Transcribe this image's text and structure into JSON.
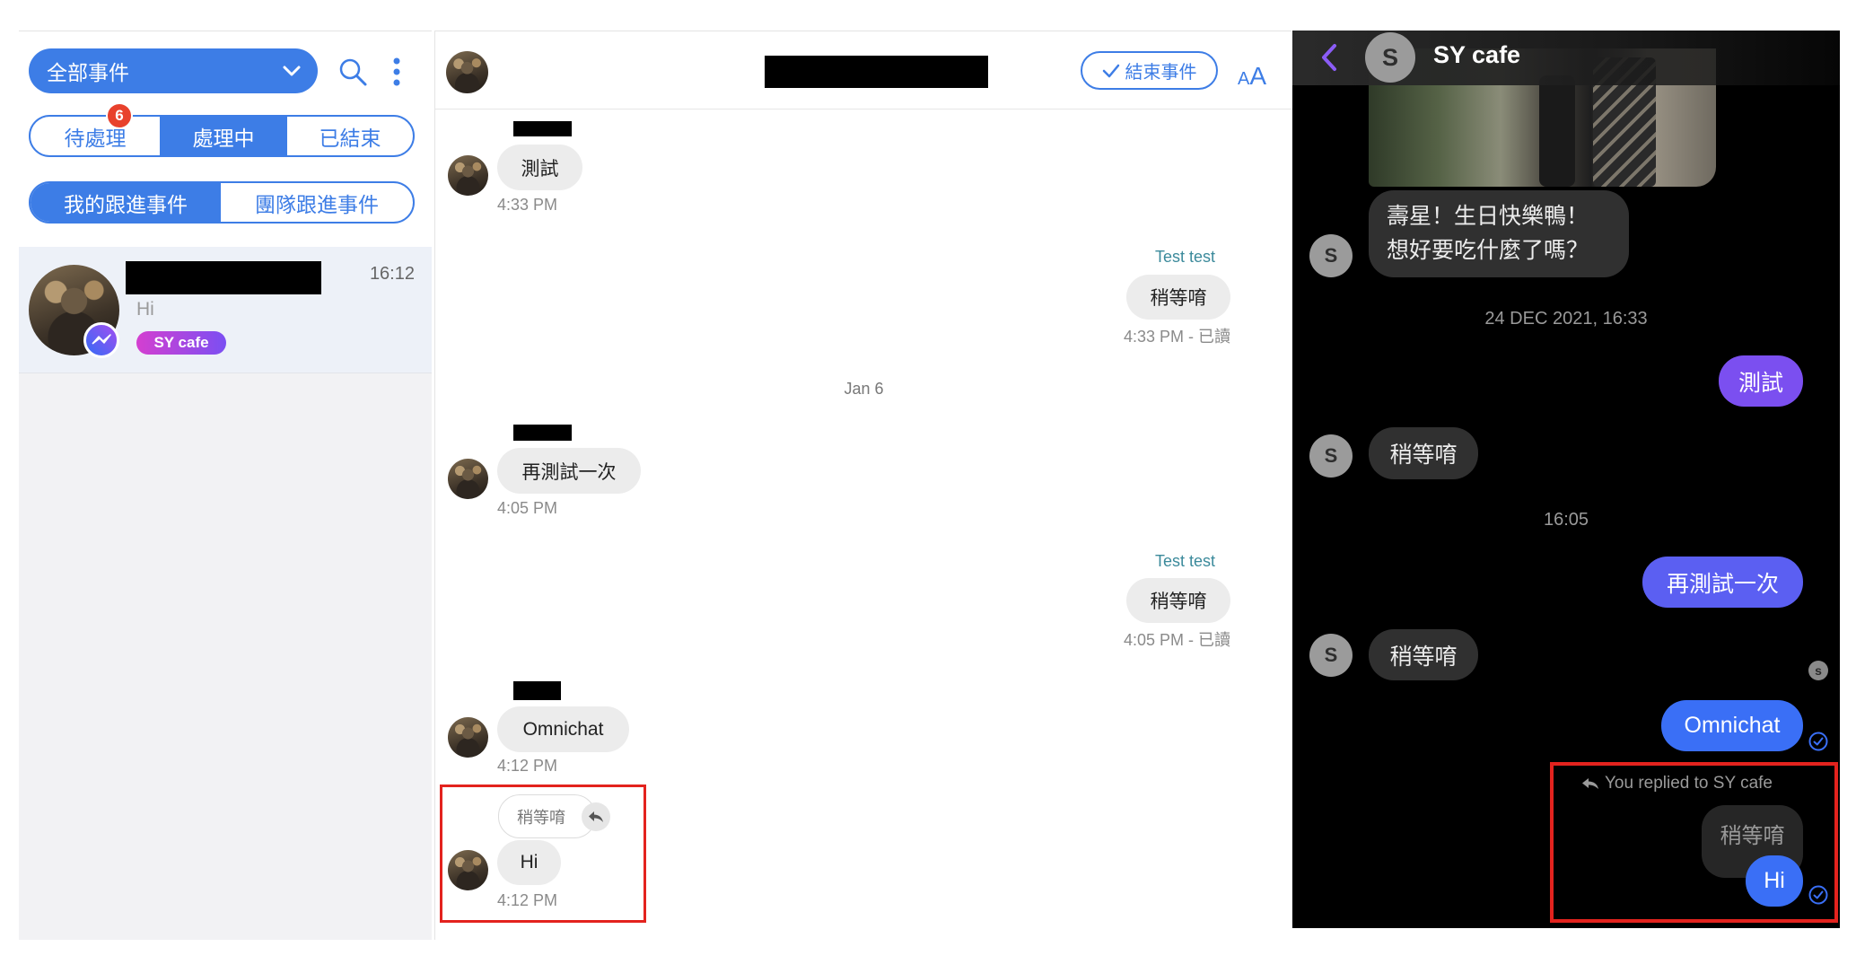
{
  "left_panel": {
    "filter_dropdown": {
      "label": "全部事件",
      "icon": "chevron-down-icon"
    },
    "status_tabs": {
      "pending": {
        "label": "待處理",
        "badge": "6"
      },
      "in_progress": {
        "label": "處理中",
        "selected": true
      },
      "closed": {
        "label": "已結束"
      }
    },
    "scope_tabs": {
      "mine": {
        "label": "我的跟進事件",
        "selected": true
      },
      "team": {
        "label": "團隊跟進事件"
      }
    },
    "conversations": [
      {
        "time": "16:12",
        "preview": "Hi",
        "tag": "SY cafe",
        "channel_icon": "messenger-icon"
      }
    ]
  },
  "chat_panel": {
    "header": {
      "end_event_label": "結束事件",
      "font_size_small": "A",
      "font_size_large": "A"
    },
    "messages": [
      {
        "direction": "in",
        "text": "測試",
        "time": "4:33 PM"
      },
      {
        "direction": "out",
        "sender": "Test test",
        "text": "稍等唷",
        "time": "4:33 PM - 已讀"
      },
      {
        "type": "date",
        "text": "Jan 6"
      },
      {
        "direction": "in",
        "text": "再測試一次",
        "time": "4:05 PM"
      },
      {
        "direction": "out",
        "sender": "Test test",
        "text": "稍等唷",
        "time": "4:05 PM - 已讀"
      },
      {
        "direction": "in",
        "text": "Omnichat",
        "time": "4:12 PM"
      },
      {
        "direction": "in",
        "reply_to": "稍等唷",
        "text": "Hi",
        "time": "4:12 PM",
        "highlighted": true
      }
    ]
  },
  "messenger_panel": {
    "header": {
      "title": "SY cafe",
      "avatar_letter": "S"
    },
    "messages": [
      {
        "direction": "in",
        "text_lines": [
          "壽星！生日快樂鴨！",
          "想好要吃什麼了嗎？"
        ]
      },
      {
        "type": "timestamp",
        "text": "24 DEC 2021, 16:33"
      },
      {
        "direction": "out",
        "text": "測試"
      },
      {
        "direction": "in",
        "text": "稍等唷"
      },
      {
        "type": "timestamp",
        "text": "16:05"
      },
      {
        "direction": "out",
        "text": "再測試一次"
      },
      {
        "direction": "in",
        "text": "稍等唷"
      },
      {
        "direction": "out",
        "text": "Omnichat"
      },
      {
        "direction": "out",
        "reply_note": "You replied to SY cafe",
        "reply_to": "稍等唷",
        "text": "Hi",
        "highlighted": true
      }
    ],
    "read_receipt_letter": "s"
  },
  "colors": {
    "accent": "#3d7de6",
    "badge": "#e8412c",
    "highlight_box": "#e3231e",
    "messenger_purple": "#7b4ff0",
    "messenger_violet": "#5b5ff2",
    "messenger_blue": "#3a6ff6",
    "sender_label": "#3b8a9b"
  }
}
